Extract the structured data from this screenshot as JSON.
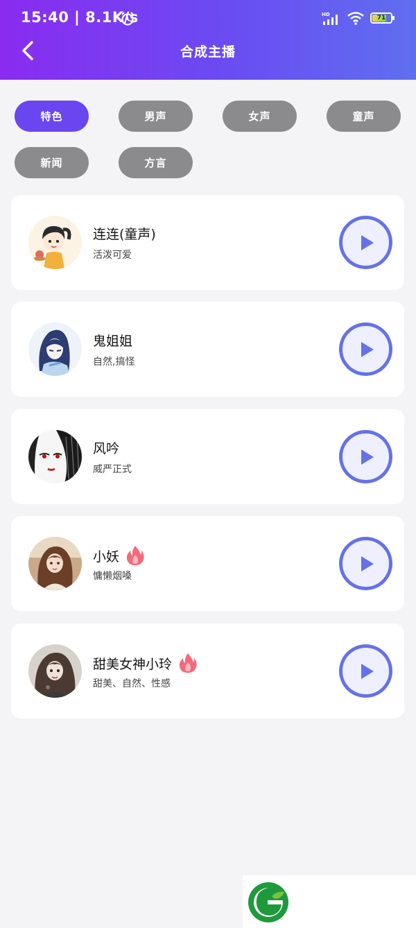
{
  "status": {
    "time": "15:40 | 8.1K/s",
    "network": "HD",
    "battery": "71"
  },
  "header": {
    "title": "合成主播"
  },
  "filters": [
    {
      "label": "特色",
      "active": true
    },
    {
      "label": "男声",
      "active": false
    },
    {
      "label": "女声",
      "active": false
    },
    {
      "label": "童声",
      "active": false
    },
    {
      "label": "新闻",
      "active": false
    },
    {
      "label": "方言",
      "active": false
    }
  ],
  "anchors": [
    {
      "name": "连连(童声)",
      "desc": "活泼可爱",
      "hot": false
    },
    {
      "name": "鬼姐姐",
      "desc": "自然,搞怪",
      "hot": false
    },
    {
      "name": "风吟",
      "desc": "威严正式",
      "hot": false
    },
    {
      "name": "小妖",
      "desc": "慵懒烟嗓",
      "hot": true
    },
    {
      "name": "甜美女神小玲",
      "desc": "甜美、自然、性感",
      "hot": true
    }
  ],
  "colors": {
    "accent": "#6a46f0",
    "chip_inactive": "#8b8b8e",
    "play": "#6572e6",
    "hot": "#f05a6a"
  },
  "icons": [
    "alarm-icon",
    "signal-icon",
    "wifi-icon",
    "battery-icon",
    "back-icon",
    "play-icon",
    "flame-icon",
    "app-logo-icon"
  ]
}
